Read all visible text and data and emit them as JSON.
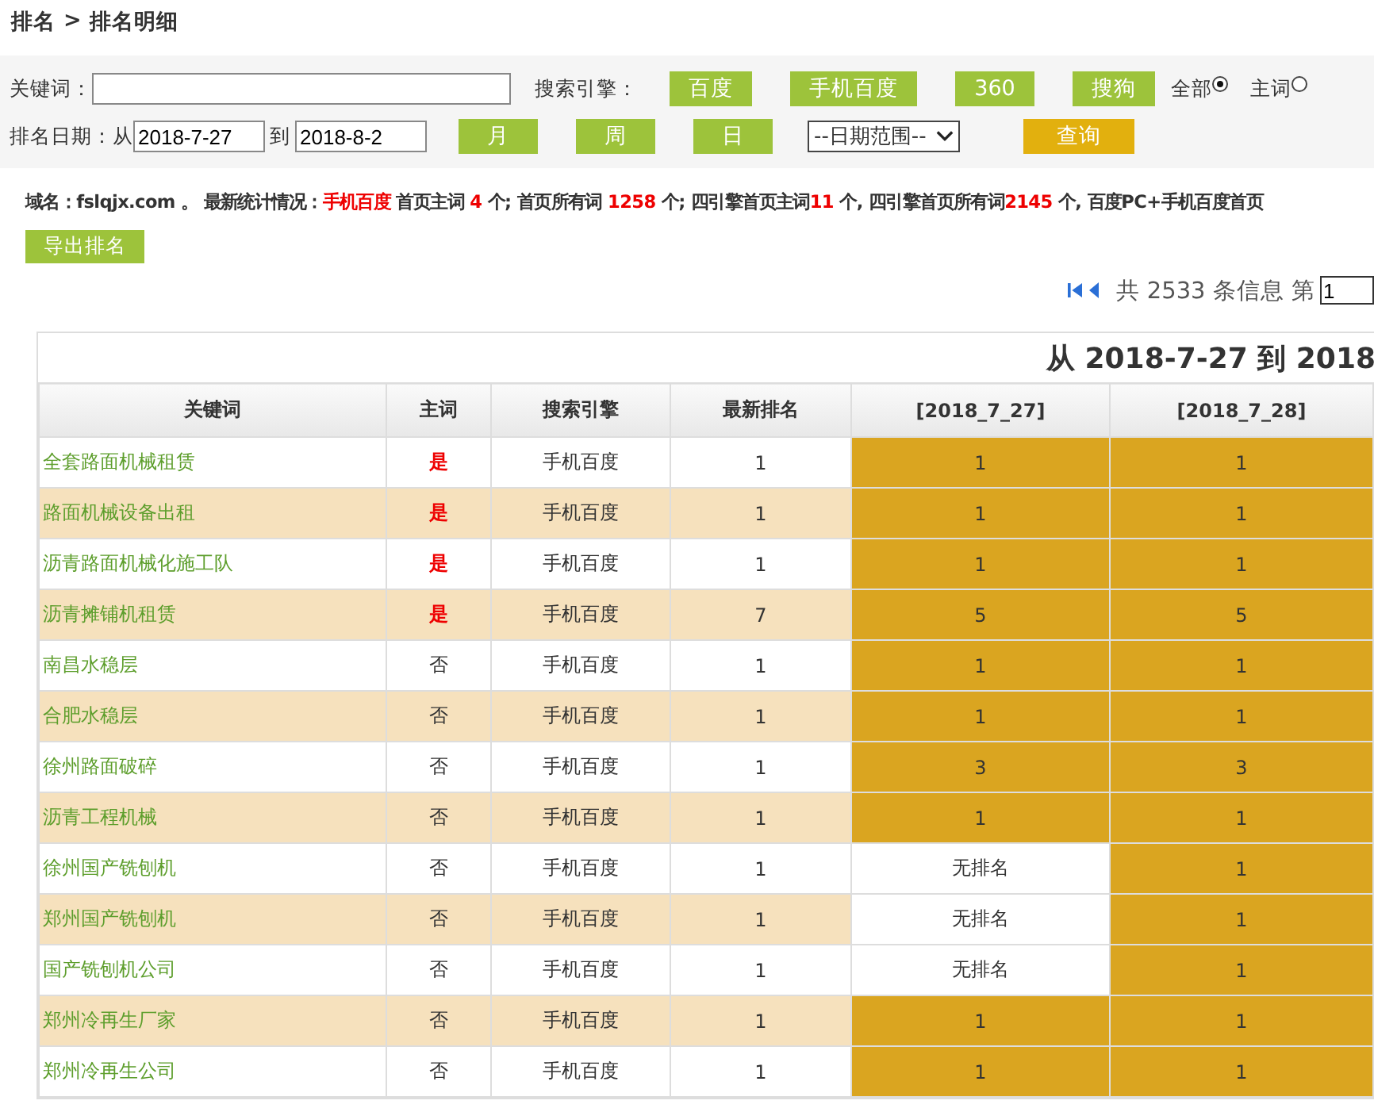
{
  "breadcrumb": {
    "root": "排名",
    "separator": ">",
    "current": "排名明细"
  },
  "filters": {
    "keyword_label": "关键词：",
    "engine_label": "搜索引擎：",
    "engines": [
      "百度",
      "手机百度",
      "360",
      "搜狗"
    ],
    "scope": [
      {
        "label": "全部",
        "selected": true
      },
      {
        "label": "主词",
        "selected": false
      }
    ],
    "date_label": "排名日期：从",
    "date_from": "2018-7-27",
    "date_to_label": "到",
    "date_to": "2018-8-2",
    "periods": [
      "月",
      "周",
      "日"
    ],
    "range_select": "--日期范围--",
    "query_button": "查询"
  },
  "stats": [
    {
      "text": "域名：fslqjx.com 。 最新统计情况：",
      "highlight": false
    },
    {
      "text": "手机百度",
      "highlight": true
    },
    {
      "text": " 首页主词 ",
      "highlight": false
    },
    {
      "text": "4",
      "highlight": true
    },
    {
      "text": " 个; 首页所有词 ",
      "highlight": false
    },
    {
      "text": "1258",
      "highlight": true
    },
    {
      "text": " 个; 四引擎首页主词",
      "highlight": false
    },
    {
      "text": "11",
      "highlight": true
    },
    {
      "text": " 个, 四引擎首页所有词",
      "highlight": false
    },
    {
      "text": "2145",
      "highlight": true
    },
    {
      "text": " 个, 百度PC+手机百度首页",
      "highlight": false
    }
  ],
  "export_button": "导出排名",
  "pager": {
    "summary": "共 2533 条信息 第",
    "page": "1"
  },
  "table": {
    "title": "从 2018-7-27 到 2018",
    "columns": [
      "关键词",
      "主词",
      "搜索引擎",
      "最新排名",
      "[2018_7_27]",
      "[2018_7_28]"
    ],
    "rows": [
      {
        "keyword": "全套路面机械租赁",
        "main": "是",
        "is_main": true,
        "engine": "手机百度",
        "latest": "1",
        "days": [
          {
            "text": "1",
            "ranked": true
          },
          {
            "text": "1",
            "ranked": true
          }
        ]
      },
      {
        "keyword": "路面机械设备出租",
        "main": "是",
        "is_main": true,
        "engine": "手机百度",
        "latest": "1",
        "days": [
          {
            "text": "1",
            "ranked": true
          },
          {
            "text": "1",
            "ranked": true
          }
        ]
      },
      {
        "keyword": "沥青路面机械化施工队",
        "main": "是",
        "is_main": true,
        "engine": "手机百度",
        "latest": "1",
        "days": [
          {
            "text": "1",
            "ranked": true
          },
          {
            "text": "1",
            "ranked": true
          }
        ]
      },
      {
        "keyword": "沥青摊铺机租赁",
        "main": "是",
        "is_main": true,
        "engine": "手机百度",
        "latest": "7",
        "days": [
          {
            "text": "5",
            "ranked": true
          },
          {
            "text": "5",
            "ranked": true
          }
        ]
      },
      {
        "keyword": "南昌水稳层",
        "main": "否",
        "is_main": false,
        "engine": "手机百度",
        "latest": "1",
        "days": [
          {
            "text": "1",
            "ranked": true
          },
          {
            "text": "1",
            "ranked": true
          }
        ]
      },
      {
        "keyword": "合肥水稳层",
        "main": "否",
        "is_main": false,
        "engine": "手机百度",
        "latest": "1",
        "days": [
          {
            "text": "1",
            "ranked": true
          },
          {
            "text": "1",
            "ranked": true
          }
        ]
      },
      {
        "keyword": "徐州路面破碎",
        "main": "否",
        "is_main": false,
        "engine": "手机百度",
        "latest": "1",
        "days": [
          {
            "text": "3",
            "ranked": true
          },
          {
            "text": "3",
            "ranked": true
          }
        ]
      },
      {
        "keyword": "沥青工程机械",
        "main": "否",
        "is_main": false,
        "engine": "手机百度",
        "latest": "1",
        "days": [
          {
            "text": "1",
            "ranked": true
          },
          {
            "text": "1",
            "ranked": true
          }
        ]
      },
      {
        "keyword": "徐州国产铣刨机",
        "main": "否",
        "is_main": false,
        "engine": "手机百度",
        "latest": "1",
        "days": [
          {
            "text": "无排名",
            "ranked": false
          },
          {
            "text": "1",
            "ranked": true
          }
        ]
      },
      {
        "keyword": "郑州国产铣刨机",
        "main": "否",
        "is_main": false,
        "engine": "手机百度",
        "latest": "1",
        "days": [
          {
            "text": "无排名",
            "ranked": false
          },
          {
            "text": "1",
            "ranked": true
          }
        ]
      },
      {
        "keyword": "国产铣刨机公司",
        "main": "否",
        "is_main": false,
        "engine": "手机百度",
        "latest": "1",
        "days": [
          {
            "text": "无排名",
            "ranked": false
          },
          {
            "text": "1",
            "ranked": true
          }
        ]
      },
      {
        "keyword": "郑州冷再生厂家",
        "main": "否",
        "is_main": false,
        "engine": "手机百度",
        "latest": "1",
        "days": [
          {
            "text": "1",
            "ranked": true
          },
          {
            "text": "1",
            "ranked": true
          }
        ]
      },
      {
        "keyword": "郑州冷再生公司",
        "main": "否",
        "is_main": false,
        "engine": "手机百度",
        "latest": "1",
        "days": [
          {
            "text": "1",
            "ranked": true
          },
          {
            "text": "1",
            "ranked": true
          }
        ]
      }
    ]
  }
}
